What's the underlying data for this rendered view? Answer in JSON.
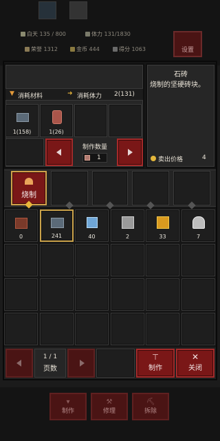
{
  "background": {
    "stats_row1": [
      {
        "label": "白天",
        "value": "135 / 800"
      },
      {
        "label": "体力",
        "value": "131/1830"
      }
    ],
    "stats_row2": [
      {
        "label": "荣誉",
        "value": "1312"
      },
      {
        "label": "金币",
        "value": "444"
      },
      {
        "label": "得分",
        "value": "1063"
      }
    ],
    "settings_label": "设置",
    "bottom_actions": [
      "制作",
      "修理",
      "拆除"
    ]
  },
  "recipe": {
    "material_header": "消耗材料",
    "stamina_header": "消耗体力",
    "stamina_value": "2(131)",
    "materials": [
      {
        "name": "stone-brick-icon",
        "count": "1(158)"
      },
      {
        "name": "clay-barrel-icon",
        "count": "1(26)"
      }
    ],
    "quantity_label": "制作数量",
    "quantity_value": "1"
  },
  "item_info": {
    "title": "石砖",
    "description": "烧制的坚硬砖块。",
    "sell_label": "卖出价格",
    "sell_value": "4"
  },
  "categories": {
    "active_label": "烧制"
  },
  "inventory": [
    {
      "icon": "chest-icon",
      "count": "0"
    },
    {
      "icon": "stone-brick-icon",
      "count": "241",
      "selected": true
    },
    {
      "icon": "glass-block-icon",
      "count": "40"
    },
    {
      "icon": "iron-book-icon",
      "count": "2"
    },
    {
      "icon": "gold-book-icon",
      "count": "33"
    },
    {
      "icon": "steel-helmet-icon",
      "count": "7"
    }
  ],
  "pagination": {
    "page": "1 / 1",
    "label": "页数"
  },
  "actions": {
    "craft_label": "制作",
    "close_label": "关闭"
  },
  "colors": {
    "accent_red": "#7a1717",
    "selection_gold": "#caa24a"
  }
}
